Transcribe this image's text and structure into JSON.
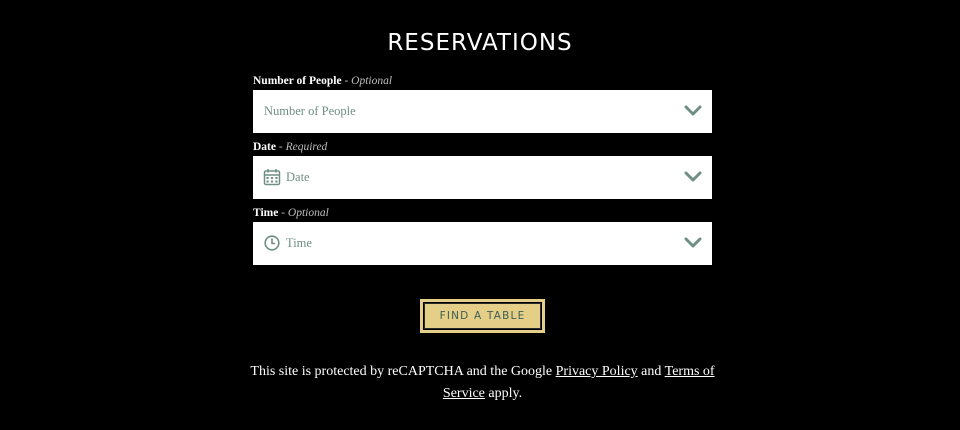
{
  "header": {
    "title": "RESERVATIONS"
  },
  "form": {
    "people": {
      "label": "Number of People",
      "hint": " - Optional",
      "placeholder": "Number of People"
    },
    "date": {
      "label": "Date",
      "hint": " - Required",
      "placeholder": "Date",
      "icon": "calendar-icon"
    },
    "time": {
      "label": "Time",
      "hint": " - Optional",
      "placeholder": "Time",
      "icon": "clock-icon"
    },
    "submit_label": "FIND A TABLE"
  },
  "legal": {
    "prefix": "This site is protected by reCAPTCHA and the Google ",
    "privacy_link": "Privacy Policy",
    "middle": " and ",
    "terms_link": "Terms of Service",
    "suffix": " apply."
  },
  "colors": {
    "background": "#000000",
    "button_fill": "#e4ce88",
    "button_text": "#3d5f54",
    "placeholder_text": "#6f8f86"
  }
}
